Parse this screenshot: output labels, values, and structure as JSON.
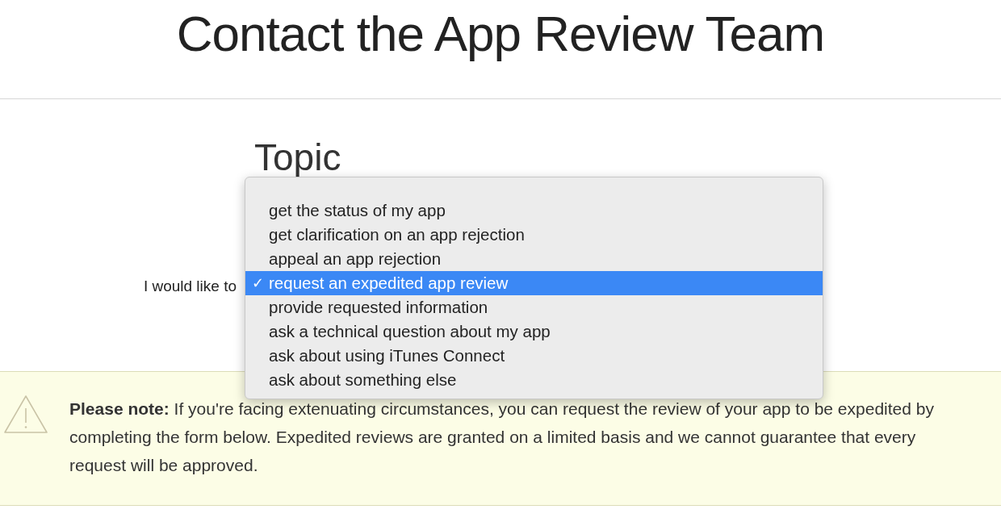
{
  "page_title": "Contact the App Review Team",
  "section_heading": "Topic",
  "field_label": "I would like to",
  "dropdown": {
    "options": [
      {
        "label": "get the status of my app",
        "selected": false
      },
      {
        "label": "get clarification on an app rejection",
        "selected": false
      },
      {
        "label": "appeal an app rejection",
        "selected": false
      },
      {
        "label": "request an expedited app review",
        "selected": true
      },
      {
        "label": "provide requested information",
        "selected": false
      },
      {
        "label": "ask a technical question about my app",
        "selected": false
      },
      {
        "label": "ask about using iTunes Connect",
        "selected": false
      },
      {
        "label": "ask about something else",
        "selected": false
      }
    ],
    "check_mark": "✓"
  },
  "notice": {
    "text": "**Please note:** If you're facing extenuating circumstances, you can request the review of your app to be expedited by completing the form below. Expedited reviews are granted on a limited basis and we cannot guarantee that every request will be approved."
  }
}
